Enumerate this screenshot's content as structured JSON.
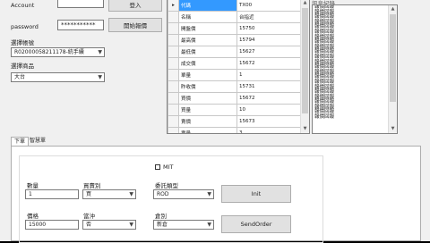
{
  "login": {
    "account_label": "Account",
    "account_value": "",
    "password_label": "password",
    "password_value": "***********",
    "login_button": "登入",
    "subscribe_button": "開始報價"
  },
  "order_account": {
    "label": "選擇帳號",
    "value": "R02000058211178-統手續"
  },
  "product": {
    "label": "選擇商品",
    "value": "大台"
  },
  "quote_grid": {
    "rows": [
      {
        "field": "代碼",
        "value": "TX00"
      },
      {
        "field": "名稱",
        "value": "台指近"
      },
      {
        "field": "開盤價",
        "value": "15750"
      },
      {
        "field": "最高價",
        "value": "15794"
      },
      {
        "field": "最低價",
        "value": "15627"
      },
      {
        "field": "成交價",
        "value": "15672"
      },
      {
        "field": "單量",
        "value": "1"
      },
      {
        "field": "昨收價",
        "value": "15731"
      },
      {
        "field": "買價",
        "value": "15672"
      },
      {
        "field": "買量",
        "value": "10"
      },
      {
        "field": "賣價",
        "value": "15673"
      },
      {
        "field": "賣量",
        "value": "3"
      }
    ]
  },
  "log": {
    "title": "訊息紀錄",
    "entries": [
      "報價回報",
      "報價回報",
      "報價回報",
      "報價回報",
      "報價回報",
      "報價回報",
      "報價回報",
      "報價回報",
      "報價回報",
      "報價回報",
      "報價回報",
      "報價回報",
      "報價回報",
      "報價回報",
      "報價回報",
      "報價回報",
      "報價回報",
      "報價回報",
      "報價回報",
      "報價回報",
      "報價回報",
      "報價回報",
      "報價回報"
    ]
  },
  "tabs": [
    {
      "label": "下單"
    },
    {
      "label": "智慧單"
    }
  ],
  "order_form": {
    "mit_label": "MIT",
    "qty_label": "數量",
    "qty_value": "1",
    "side_label": "買賣別",
    "side_value": "買",
    "order_type_label": "委託類型",
    "order_type_value": "ROD",
    "init_button": "Init",
    "price_label": "價格",
    "price_value": "15000",
    "offset_label": "當沖",
    "offset_value": "否",
    "position_label": "倉別",
    "position_value": "新倉",
    "send_button": "SendOrder"
  }
}
